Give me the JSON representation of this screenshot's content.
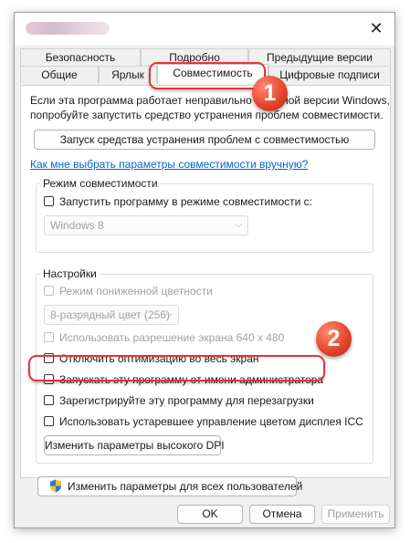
{
  "dialog": {
    "close_glyph": "✕"
  },
  "tabs": {
    "row1": [
      "Безопасность",
      "Подробно",
      "Предыдущие версии"
    ],
    "row2": [
      "Общие",
      "Ярлык",
      "Совместимость",
      "Цифровые подписи"
    ],
    "active": "Совместимость"
  },
  "intro": {
    "line1": "Если эта программа работает неправильно в данной версии Windows,",
    "line2": "попробуйте запустить средство устранения проблем совместимости."
  },
  "troubleshoot_button": "Запуск средства устранения проблем с совместимостью",
  "manual_link": "Как мне выбрать параметры совместимости вручную?",
  "compat_mode": {
    "group_label": "Режим совместимости",
    "checkbox_label": "Запустить программу в режиме совместимости с:",
    "checked": false,
    "os_value": "Windows 8"
  },
  "settings": {
    "group_label": "Настройки",
    "reduced_color": "Режим пониженной цветности",
    "color_value": "8-разрядный цвет (256)",
    "res_640": "Использовать разрешение экрана 640 x 480",
    "disable_fullscreen": "Отключить оптимизацию во весь экран",
    "run_as_admin": "Запускать эту программу от имени администратора",
    "register_restart": "Зарегистрируйте эту программу для перезагрузки",
    "icc": "Использовать устаревшее управление цветом дисплея ICC",
    "dpi_button": "Изменить параметры высокого DPI"
  },
  "all_users_button": "Изменить параметры для всех пользователей",
  "footer": {
    "ok": "OK",
    "cancel": "Отмена",
    "apply": "Применить"
  },
  "annotations": {
    "badge1": "1",
    "badge2": "2"
  },
  "colors": {
    "callout": "#e8313a",
    "link": "#0066cc",
    "badge": "#e24229"
  }
}
